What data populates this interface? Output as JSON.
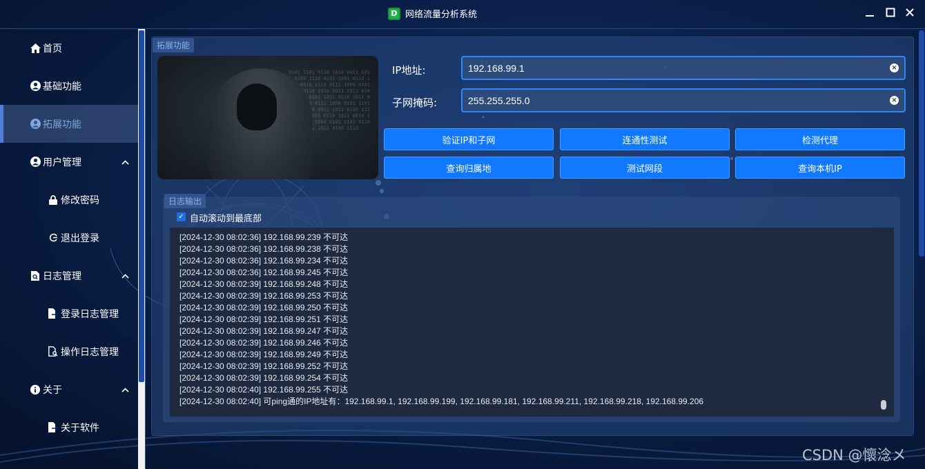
{
  "window": {
    "title": "网络流量分析系统",
    "icon_letter": "D",
    "min_icon": "minimize-icon",
    "max_icon": "maximize-icon",
    "close_icon": "close-icon"
  },
  "sidebar": {
    "items": [
      {
        "label": "首页",
        "icon": "home-icon"
      },
      {
        "label": "基础功能",
        "icon": "user-circle-icon"
      },
      {
        "label": "拓展功能",
        "icon": "user-circle-icon",
        "active": true
      },
      {
        "label": "用户管理",
        "icon": "user-circle-icon",
        "expanded": true
      },
      {
        "label": "修改密码",
        "icon": "lock-icon"
      },
      {
        "label": "退出登录",
        "icon": "logout-icon"
      },
      {
        "label": "日志管理",
        "icon": "log-search-icon",
        "expanded": true
      },
      {
        "label": "登录日志管理",
        "icon": "file-export-icon"
      },
      {
        "label": "操作日志管理",
        "icon": "file-search-icon"
      },
      {
        "label": "关于",
        "icon": "info-icon",
        "expanded": true
      },
      {
        "label": "关于软件",
        "icon": "file-export-icon"
      }
    ]
  },
  "ext": {
    "group_title": "拓展功能",
    "ip_label": "IP地址:",
    "ip_value": "192.168.99.1",
    "mask_label": "子网掩码:",
    "mask_value": "255.255.255.0",
    "buttons": [
      "验证IP和子网",
      "连通性测试",
      "检测代理",
      "查询归属地",
      "测试网段",
      "查询本机IP"
    ]
  },
  "log": {
    "group_title": "日志输出",
    "autoscroll_label": "自动滚动到最底部",
    "autoscroll_checked": true,
    "lines": [
      "[2024-12-30 08:02:36] 192.168.99.239 不可达",
      "[2024-12-30 08:02:36] 192.168.99.238 不可达",
      "[2024-12-30 08:02:36] 192.168.99.234 不可达",
      "[2024-12-30 08:02:36] 192.168.99.245 不可达",
      "[2024-12-30 08:02:39] 192.168.99.248 不可达",
      "[2024-12-30 08:02:39] 192.168.99.253 不可达",
      "[2024-12-30 08:02:39] 192.168.99.250 不可达",
      "[2024-12-30 08:02:39] 192.168.99.251 不可达",
      "[2024-12-30 08:02:39] 192.168.99.247 不可达",
      "[2024-12-30 08:02:39] 192.168.99.246 不可达",
      "[2024-12-30 08:02:39] 192.168.99.249 不可达",
      "[2024-12-30 08:02:39] 192.168.99.252 不可达",
      "[2024-12-30 08:02:39] 192.168.99.254 不可达",
      "[2024-12-30 08:02:40] 192.168.99.255 不可达",
      "[2024-12-30 08:02:40] 可ping通的IP地址有：192.168.99.1, 192.168.99.199, 192.168.99.181, 192.168.99.211, 192.168.99.218, 192.168.99.206"
    ]
  },
  "watermark": "CSDN @懷淰メ",
  "colors": {
    "accent": "#1179ff",
    "field_border": "#3385ff",
    "bg_dark": "#081a3d"
  }
}
